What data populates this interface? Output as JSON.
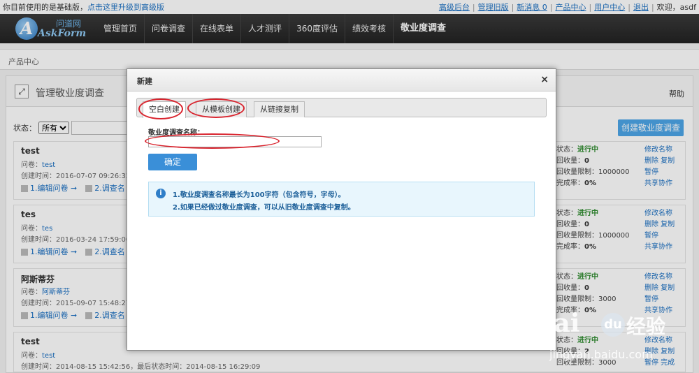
{
  "topbar": {
    "notice": "你目前使用的是基础版，",
    "upgrade_link": "点击这里升级到高级版",
    "links": [
      "高级后台",
      "管理旧版",
      "新消息 0",
      "产品中心",
      "用户中心",
      "退出"
    ],
    "greeting": "欢迎，asdf"
  },
  "logo": {
    "cn": "问道网",
    "en": "AskForm",
    "mark": "A"
  },
  "nav": {
    "items": [
      "管理首页",
      "问卷调查",
      "在线表单",
      "人才测评",
      "360度评估",
      "绩效考核",
      "敬业度调查"
    ]
  },
  "breadcrumb": "产品中心",
  "panel": {
    "title": "管理敬业度调查",
    "help": "帮助",
    "filter_label": "状态：",
    "filter_value": "所有",
    "create_button": "创建敬业度调查"
  },
  "surveys": [
    {
      "name": "test",
      "q_label": "问卷：",
      "q": "test",
      "created": "创建时间：2016-07-07 09:26:32，",
      "act1": "1.编辑问卷",
      "act2": "2.调查名",
      "status_label": "状态：",
      "status": "进行中",
      "collected_label": "回收量：",
      "collected": "0",
      "limit_label": "回收量限制：",
      "limit": "1000000",
      "rate_label": "完成率：",
      "rate": "0%",
      "op1": "修改名称",
      "op2": "删除 复制",
      "op3": "暂停",
      "op4": "共享协作"
    },
    {
      "name": "tes",
      "q_label": "问卷：",
      "q": "tes",
      "created": "创建时间：2016-03-24 17:59:00，",
      "act1": "1.编辑问卷",
      "act2": "2.调查名",
      "status_label": "状态：",
      "status": "进行中",
      "collected_label": "回收量：",
      "collected": "0",
      "limit_label": "回收量限制：",
      "limit": "1000000",
      "rate_label": "完成率：",
      "rate": "0%",
      "op1": "修改名称",
      "op2": "删除 复制",
      "op3": "暂停",
      "op4": "共享协作"
    },
    {
      "name": "阿斯蒂芬",
      "q_label": "问卷：",
      "q": "阿斯蒂芬",
      "created": "创建时间：2015-09-07 15:48:27，",
      "act1": "1.编辑问卷",
      "act2": "2.调查名",
      "status_label": "状态：",
      "status": "进行中",
      "collected_label": "回收量：",
      "collected": "0",
      "limit_label": "回收量限制：",
      "limit": "3000",
      "rate_label": "完成率：",
      "rate": "0%",
      "op1": "修改名称",
      "op2": "删除 复制",
      "op3": "暂停",
      "op4": "共享协作"
    },
    {
      "name": "test",
      "q_label": "问卷：",
      "q": "test",
      "created": "创建时间：2014-08-15 15:42:56，最后状态时间：2014-08-15 16:29:09",
      "act1": "",
      "act2": "",
      "status_label": "状态：",
      "status": "进行中",
      "collected_label": "回收量：",
      "collected": "2",
      "limit_label": "回收量限制：",
      "limit": "3000",
      "rate_label": "",
      "rate": "",
      "op1": "修改名称",
      "op2": "删除 复制",
      "op3": "暂停 完成",
      "op4": ""
    }
  ],
  "modal": {
    "title": "新建",
    "close": "×",
    "tabs": [
      "空白创建",
      "从模板创建",
      "从链接复制"
    ],
    "field_label": "敬业度调查名称：",
    "confirm": "确定",
    "tip_icon": "i",
    "tips": [
      "1.敬业度调查名称最长为100字符（包含符号，字母）。",
      "2.如果已经做过敬业度调查，可以从旧敬业度调查中复制。"
    ]
  },
  "watermark": {
    "brand": "Bai",
    "paw": "du",
    "jingyan": "经验",
    "url": "jingyan.baidu.com"
  },
  "colors": {
    "nav_bg": "#2b2b2b",
    "link": "#1a6fc2",
    "primary": "#3a8fd8",
    "running": "#2e8b2e",
    "annotation": "#d9232d"
  }
}
